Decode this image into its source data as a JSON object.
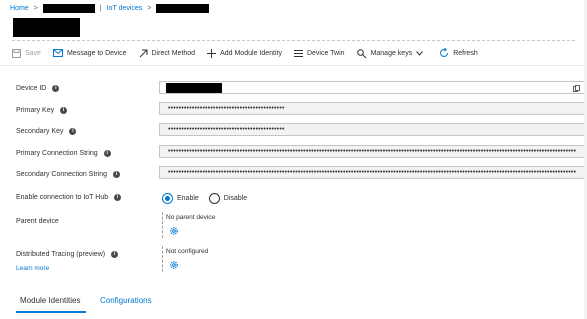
{
  "breadcrumb": {
    "home": "Home",
    "iot_devices": "IoT devices"
  },
  "toolbar": {
    "save": "Save",
    "message": "Message to Device",
    "direct_method": "Direct Method",
    "add_module": "Add Module Identity",
    "device_twin": "Device Twin",
    "manage_keys": "Manage keys",
    "refresh": "Refresh"
  },
  "form": {
    "device_id_label": "Device ID",
    "primary_key_label": "Primary Key",
    "primary_key_value": "••••••••••••••••••••••••••••••••••••••••••••",
    "secondary_key_label": "Secondary Key",
    "secondary_key_value": "••••••••••••••••••••••••••••••••••••••••••••",
    "primary_conn_label": "Primary Connection String",
    "primary_conn_value": "••••••••••••••••••••••••••••••••••••••••••••••••••••••••••••••••••••••••••••••••••••••••••••••••••••••••••••••••••••••••••••••••••••••••••••••••••••••••••",
    "secondary_conn_label": "Secondary Connection String",
    "secondary_conn_value": "••••••••••••••••••••••••••••••••••••••••••••••••••••••••••••••••••••••••••••••••••••••••••••••••••••••••••••••••••••••••••••••••••••••••••••••••••••••••••",
    "enable_label": "Enable connection to IoT Hub",
    "enable_option": "Enable",
    "disable_option": "Disable",
    "parent_label": "Parent device",
    "parent_value": "No parent device",
    "tracing_label": "Distributed Tracing (preview)",
    "learn_more": "Learn more",
    "tracing_value": "Not configured"
  },
  "tabs": {
    "module_identities": "Module Identities",
    "configurations": "Configurations"
  },
  "colors": {
    "accent": "#0078d4"
  }
}
